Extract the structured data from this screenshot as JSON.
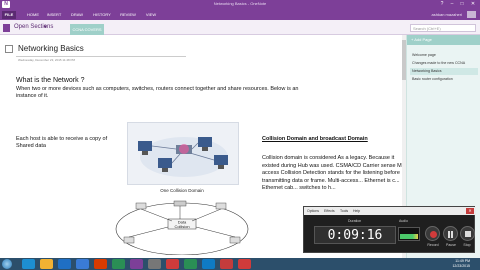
{
  "app": {
    "title": "Networking Basics - OneNote",
    "icon_label": "N"
  },
  "window_controls": {
    "help": "?",
    "minimize": "–",
    "maximize": "□",
    "close": "✕"
  },
  "ribbon": {
    "tabs": [
      "FILE",
      "HOME",
      "INSERT",
      "DRAW",
      "HISTORY",
      "REVIEW",
      "VIEW"
    ],
    "user": "ashkan mazaheri"
  },
  "notebook": {
    "label": "Open Sections",
    "chevron": "▾",
    "section_tab": "CCNA COVERS",
    "search_placeholder": "Search (Ctrl+E)"
  },
  "page": {
    "title": "Networking Basics",
    "date": "Wednesday, December 23, 2015  11:48 PM",
    "heading_network": "What is the Network ?",
    "para_network": "When two or more devices such as computers, switches, routers connect together and share resources. Below is an instance of it.",
    "para_host": "Each host is able to receive a copy of Shared data",
    "diagram_title": "One Collision Domain",
    "diagram_center_label": "Data Collision",
    "heading_collision": "Collision Domain and broadcast Domain",
    "para_collision": "Collision domain is considered As a legacy. Because it existed during Hub was used. CSMA/CD Carrier sense Multi-access Collision Detection stands for the listening before transmitting data or frame. Multi-access... Ethernet is c... Ethernet cab... switches to h..."
  },
  "pages_pane": {
    "add_page": "+ Add Page",
    "items": [
      "Welcome page",
      "Changes made to the new CCNA",
      "Networking Basics",
      "Basic router configuration"
    ],
    "active_index": 2
  },
  "recorder": {
    "menus": [
      "Options",
      "Effects",
      "Tools",
      "Help"
    ],
    "duration_label": "Duration",
    "time": "0:09:16",
    "audio_label": "Audio",
    "record_label": "Record",
    "pause_label": "Pause",
    "stop_label": "Stop"
  },
  "taskbar": {
    "time": "11:49 PM",
    "date": "12/23/2015",
    "icon_colors": [
      "#1d8fd1",
      "#f2b233",
      "#1f6fc4",
      "#3a7bd5",
      "#d83b01",
      "#2a8f55",
      "#7d3f98",
      "#777777",
      "#d03b3b",
      "#2a8f55",
      "#0f7bc4",
      "#c43c3c",
      "#d03b3b"
    ]
  }
}
